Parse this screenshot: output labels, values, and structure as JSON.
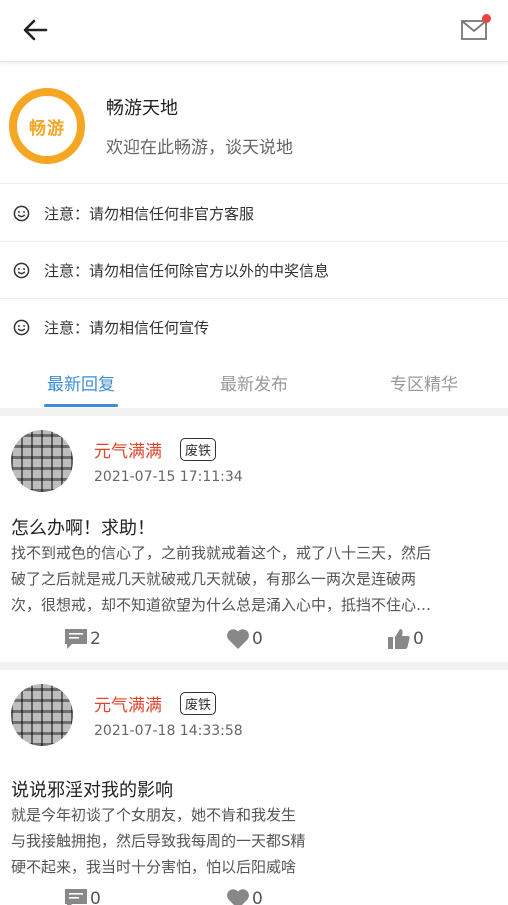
{
  "header": {
    "back_icon": "arrow-left-icon",
    "mail_icon": "mail-icon",
    "colors": {
      "notification_dot": "#e8453c"
    }
  },
  "forum": {
    "logo_text": "畅游",
    "name": "畅游天地",
    "description": "欢迎在此畅游，谈天说地",
    "colors": {
      "logo": "#f5a623"
    }
  },
  "notices": [
    {
      "icon": "smiley-icon",
      "text": "注意：请勿相信任何非官方客服"
    },
    {
      "icon": "smiley-icon",
      "text": "注意：请勿相信任何除官方以外的中奖信息"
    },
    {
      "icon": "smiley-icon",
      "text": "注意：请勿相信任何宣传"
    }
  ],
  "tabs": [
    {
      "label": "最新回复",
      "active": true
    },
    {
      "label": "最新发布",
      "active": false
    },
    {
      "label": "专区精华",
      "active": false
    }
  ],
  "posts": [
    {
      "author": "元气满满",
      "rank": "废铁",
      "time": "2021-07-15 17:11:34",
      "title": "怎么办啊！求助！",
      "body_lines": [
        "找不到戒色的信心了，之前我就戒着这个，戒了八十三天，然后",
        "破了之后就是戒几天就破戒几天就破，有那么一两次是连破两",
        "次，很想戒，却不知道欲望为什么总是涌入心中，抵挡不住心…"
      ],
      "comments": "2",
      "likes": "0",
      "thumbs": "0"
    },
    {
      "author": "元气满满",
      "rank": "废铁",
      "time": "2021-07-18 14:33:58",
      "title": "说说邪淫对我的影响",
      "body_lines": [
        "就是今年初谈了个女朋友，她不肯和我发生",
        "与我接触拥抱，然后导致我每周的一天都S精",
        "硬不起来，我当时十分害怕，怕以后阳威啥"
      ],
      "comments": "0",
      "likes": "0"
    }
  ],
  "colors": {
    "accent": "#3b8ed6",
    "author": "#e0452e"
  }
}
